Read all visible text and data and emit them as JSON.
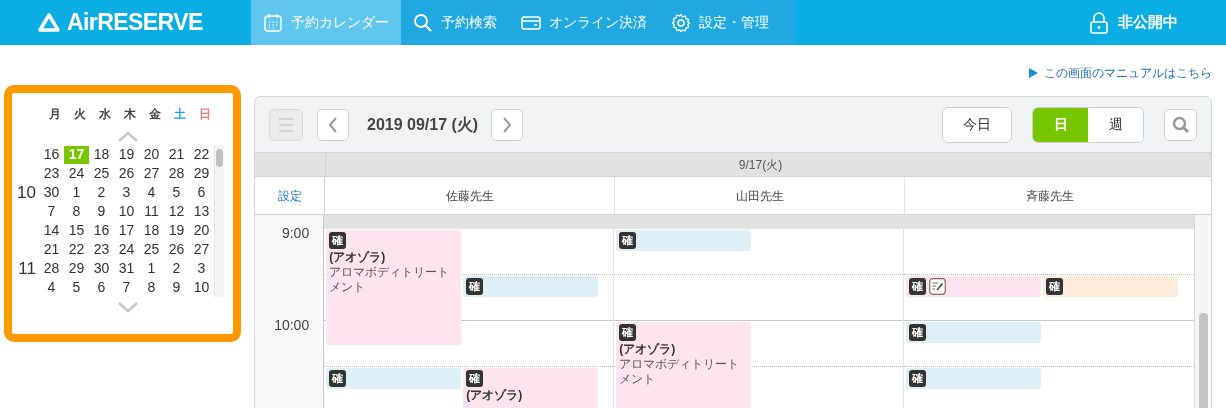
{
  "header": {
    "logo": "AirRESERVE",
    "nav": [
      {
        "label": "予約カレンダー",
        "selected": true
      },
      {
        "label": "予約検索",
        "selected": false
      },
      {
        "label": "オンライン決済",
        "selected": false
      },
      {
        "label": "設定・管理",
        "selected": false
      }
    ],
    "status": "非公開中"
  },
  "manual_link": "この画面のマニュアルはこちら",
  "mini_calendar": {
    "weekdays": [
      "月",
      "火",
      "水",
      "木",
      "金",
      "土",
      "日"
    ],
    "weeks": [
      {
        "days": [
          {
            "day": "16",
            "selected": false
          },
          {
            "day": "17",
            "selected": true
          },
          {
            "day": "18",
            "selected": false
          },
          {
            "day": "19",
            "selected": false
          },
          {
            "day": "20",
            "selected": false
          },
          {
            "day": "21",
            "selected": false
          },
          {
            "day": "22",
            "selected": false
          }
        ]
      },
      {
        "days": [
          {
            "day": "23",
            "selected": false
          },
          {
            "day": "24",
            "selected": false
          },
          {
            "day": "25",
            "selected": false
          },
          {
            "day": "26",
            "selected": false
          },
          {
            "day": "27",
            "selected": false
          },
          {
            "day": "28",
            "selected": false
          },
          {
            "day": "29",
            "selected": false
          }
        ]
      },
      {
        "month": "10",
        "days": [
          {
            "day": "30",
            "selected": false
          },
          {
            "day": "1",
            "selected": false
          },
          {
            "day": "2",
            "selected": false
          },
          {
            "day": "3",
            "selected": false
          },
          {
            "day": "4",
            "selected": false
          },
          {
            "day": "5",
            "selected": false
          },
          {
            "day": "6",
            "selected": false
          }
        ]
      },
      {
        "days": [
          {
            "day": "7",
            "selected": false
          },
          {
            "day": "8",
            "selected": false
          },
          {
            "day": "9",
            "selected": false
          },
          {
            "day": "10",
            "selected": false
          },
          {
            "day": "11",
            "selected": false
          },
          {
            "day": "12",
            "selected": false
          },
          {
            "day": "13",
            "selected": false
          }
        ]
      },
      {
        "days": [
          {
            "day": "14",
            "selected": false
          },
          {
            "day": "15",
            "selected": false
          },
          {
            "day": "16",
            "selected": false
          },
          {
            "day": "17",
            "selected": false
          },
          {
            "day": "18",
            "selected": false
          },
          {
            "day": "19",
            "selected": false
          },
          {
            "day": "20",
            "selected": false
          }
        ]
      },
      {
        "days": [
          {
            "day": "21",
            "selected": false
          },
          {
            "day": "22",
            "selected": false
          },
          {
            "day": "23",
            "selected": false
          },
          {
            "day": "24",
            "selected": false
          },
          {
            "day": "25",
            "selected": false
          },
          {
            "day": "26",
            "selected": false
          },
          {
            "day": "27",
            "selected": false
          }
        ]
      },
      {
        "month": "11",
        "days": [
          {
            "day": "28",
            "selected": false
          },
          {
            "day": "29",
            "selected": false
          },
          {
            "day": "30",
            "selected": false
          },
          {
            "day": "31",
            "selected": false
          },
          {
            "day": "1",
            "selected": false
          },
          {
            "day": "2",
            "selected": false
          },
          {
            "day": "3",
            "selected": false
          }
        ]
      },
      {
        "days": [
          {
            "day": "4",
            "selected": false
          },
          {
            "day": "5",
            "selected": false
          },
          {
            "day": "6",
            "selected": false
          },
          {
            "day": "7",
            "selected": false
          },
          {
            "day": "8",
            "selected": false
          },
          {
            "day": "9",
            "selected": false
          },
          {
            "day": "10",
            "selected": false
          }
        ]
      }
    ]
  },
  "toolbar": {
    "menu_disabled": true,
    "date": "2019 09/17 (火)",
    "today": "今日",
    "view_options": [
      {
        "label": "日",
        "selected": true
      },
      {
        "label": "週",
        "selected": false
      }
    ]
  },
  "schedule": {
    "date_header": "9/17(火)",
    "settings_link": "設定",
    "times": [
      "9:00",
      "10:00"
    ],
    "staff": [
      {
        "name": "佐藤先生",
        "events": [
          {
            "badge": "確",
            "title": "(アオゾラ)",
            "menu": "アロマボディトリートメント",
            "color": "#fde4ee",
            "memo": false
          },
          {
            "badge": "確",
            "color": "#ddf0f8",
            "memo": false
          },
          {
            "badge": "確",
            "color": "#ddf0f8",
            "memo": false
          },
          {
            "badge": "確",
            "title": "(アオゾラ)",
            "color": "#fde4ee",
            "memo": false
          }
        ]
      },
      {
        "name": "山田先生",
        "events": [
          {
            "badge": "確",
            "color": "#ddf0f8",
            "memo": false
          },
          {
            "badge": "確",
            "title": "(アオゾラ)",
            "menu": "アロマボディトリートメント",
            "color": "#fde4ee",
            "memo": false
          }
        ]
      },
      {
        "name": "斉藤先生",
        "events": [
          {
            "badge": "確",
            "color": "#fde4ee",
            "memo": true
          },
          {
            "badge": "確",
            "color": "#fdecd9",
            "memo": false
          },
          {
            "badge": "確",
            "color": "#ddf0f8",
            "memo": false
          },
          {
            "badge": "確",
            "color": "#ddf0f8",
            "memo": false
          }
        ]
      }
    ]
  }
}
